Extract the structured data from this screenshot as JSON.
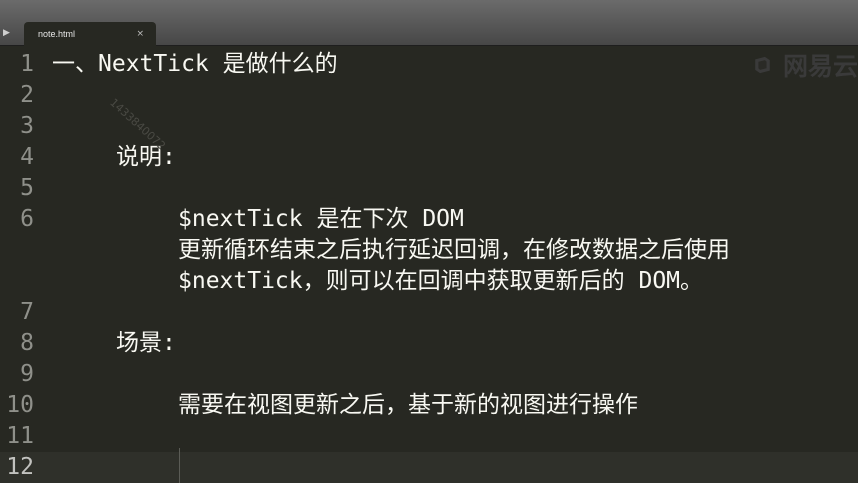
{
  "tab": {
    "title": "note.html",
    "close_glyph": "×",
    "arrow_glyph": "▶"
  },
  "editor": {
    "line_numbers": [
      "1",
      "2",
      "3",
      "4",
      "5",
      "6",
      "7",
      "8",
      "9",
      "10",
      "11",
      "12"
    ],
    "lines": {
      "l1": "一、NextTick 是做什么的",
      "l4": "说明:",
      "l6a": "$nextTick 是在下次 DOM",
      "l6b": "更新循环结束之后执行延迟回调，在修改数据之后使用",
      "l6c": "$nextTick，则可以在回调中获取更新后的 DOM。",
      "l8": "场景:",
      "l10": "需要在视图更新之后，基于新的视图进行操作"
    },
    "active_line": "12"
  },
  "watermark": {
    "brand": "网易云",
    "id_text": "1433840072"
  },
  "colors": {
    "background": "#272822",
    "text": "#f8f8f2",
    "gutter_text": "#8f908a"
  }
}
